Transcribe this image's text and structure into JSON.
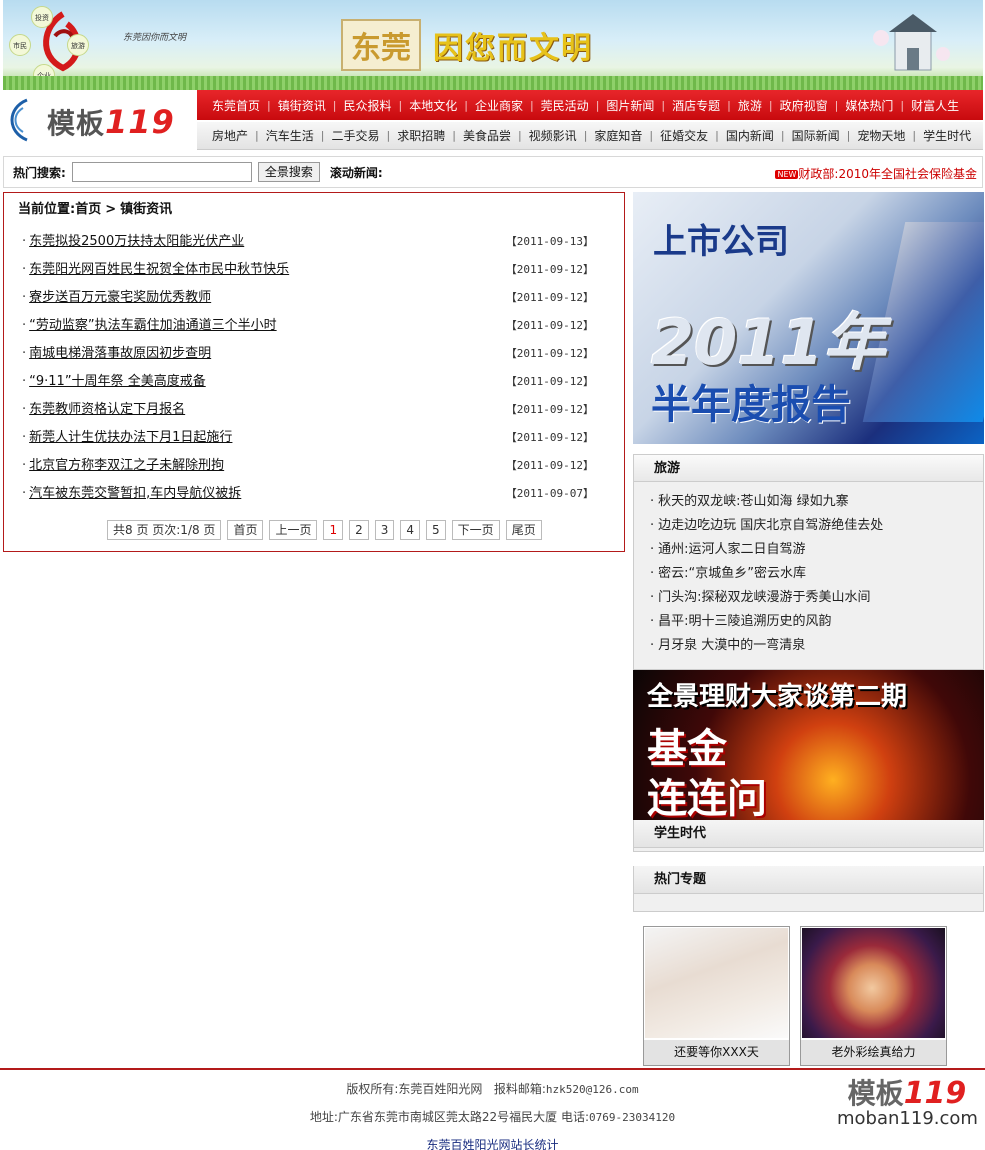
{
  "banner": {
    "bubbles": [
      "投资",
      "市民",
      "旅游",
      "企业"
    ],
    "logo_text": "东莞因你而文明",
    "city": "东莞",
    "motto": "因您而文明"
  },
  "site_logo": {
    "cn": "模板",
    "num": "119"
  },
  "nav_primary": [
    "东莞首页",
    "镇街资讯",
    "民众报料",
    "本地文化",
    "企业商家",
    "莞民活动",
    "图片新闻",
    "酒店专题",
    "旅游",
    "政府视窗",
    "媒体热门",
    "财富人生"
  ],
  "nav_secondary": [
    "房地产",
    "汽车生活",
    "二手交易",
    "求职招聘",
    "美食品尝",
    "视频影讯",
    "家庭知音",
    "征婚交友",
    "国内新闻",
    "国际新闻",
    "宠物天地",
    "学生时代"
  ],
  "search": {
    "label": "热门搜索:",
    "value": "",
    "button": "全景搜索",
    "news_label": "滚动新闻:",
    "ticker_badge": "NEW",
    "ticker_text": "财政部:2010年全国社会保险基金"
  },
  "breadcrumb": {
    "label": "当前位置:首页",
    "arrow": ">",
    "current": "镇街资讯"
  },
  "articles": [
    {
      "title": "东莞拟投2500万扶持太阳能光伏产业",
      "date": "【2011-09-13】"
    },
    {
      "title": "东莞阳光网百姓民生祝贺全体市民中秋节快乐",
      "date": "【2011-09-12】"
    },
    {
      "title": "寮步送百万元豪宅奖励优秀教师",
      "date": "【2011-09-12】"
    },
    {
      "title": "“劳动监察”执法车霸住加油通道三个半小时",
      "date": "【2011-09-12】"
    },
    {
      "title": "南城电梯滑落事故原因初步查明",
      "date": "【2011-09-12】"
    },
    {
      "title": "“9·11”十周年祭 全美高度戒备",
      "date": "【2011-09-12】"
    },
    {
      "title": "东莞教师资格认定下月报名",
      "date": "【2011-09-12】"
    },
    {
      "title": "新莞人计生优扶办法下月1日起施行",
      "date": "【2011-09-12】"
    },
    {
      "title": "北京官方称李双江之子未解除刑拘",
      "date": "【2011-09-12】"
    },
    {
      "title": "汽车被东莞交警暂扣,车内导航仪被拆",
      "date": "【2011-09-07】"
    }
  ],
  "pager": {
    "summary": "共8 页 页次:1/8 页",
    "first": "首页",
    "prev": "上一页",
    "pages": [
      "1",
      "2",
      "3",
      "4",
      "5"
    ],
    "current": "1",
    "next": "下一页",
    "last": "尾页"
  },
  "ad_report": {
    "line1": "上市公司",
    "line2": "2011年",
    "line3": "半年度报告"
  },
  "travel": {
    "title": "旅游",
    "items": [
      "秋天的双龙峡:苍山如海 绿如九寨",
      "边走边吃边玩 国庆北京自驾游绝佳去处",
      "通州:运河人家二日自驾游",
      "密云:“京城鱼乡”密云水库",
      "门头沟:探秘双龙峡漫游于秀美山水间",
      "昌平:明十三陵追溯历史的风韵",
      "月牙泉 大漠中的一弯清泉"
    ]
  },
  "ad_finance": {
    "line1": "全景理财大家谈第二期",
    "line2": "基金",
    "line3": "连连问"
  },
  "student_title": "学生时代",
  "hot_title": "热门专题",
  "thumbs": [
    {
      "caption": "还要等你XXX天"
    },
    {
      "caption": "老外彩绘真给力"
    }
  ],
  "footer": {
    "copyright_label": "版权所有:东莞百姓阳光网",
    "email_label": "报料邮箱:",
    "email": "hzk520@126.com",
    "address_label": "地址:广东省东莞市南城区莞太路22号福民大厦 电话:",
    "phone": "0769-23034120",
    "stats": "东莞百姓阳光网站长统计",
    "logo_cn": "模板",
    "logo_num": "119",
    "logo_url": "moban119.com"
  },
  "colors": {
    "brand_red": "#c80a0e",
    "border_red": "#b31a1a"
  }
}
